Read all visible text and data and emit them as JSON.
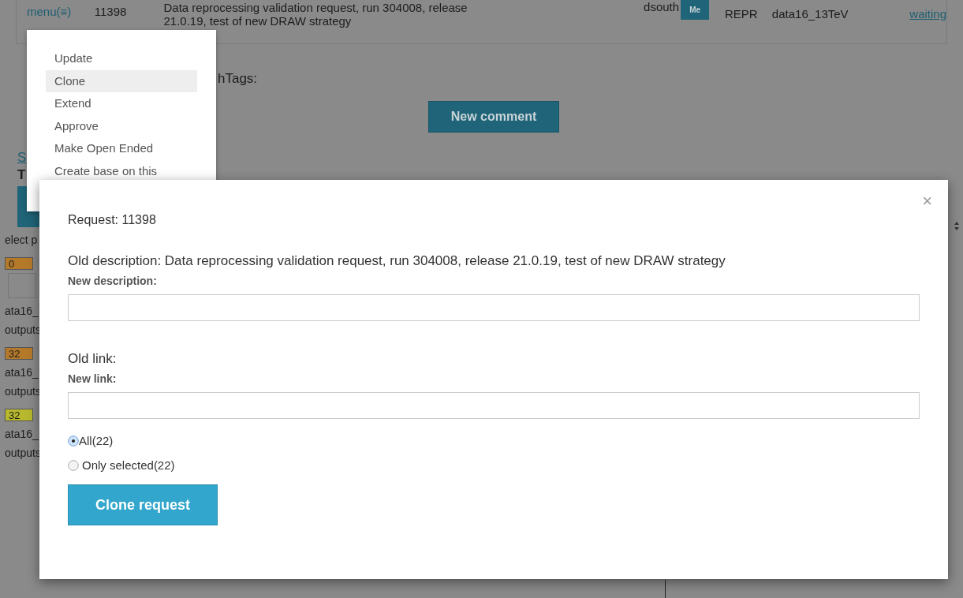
{
  "request_row": {
    "menu_link": "menu(≡)",
    "id": "11398",
    "description": "Data reprocessing validation request, run 304008, release 21.0.19, test of new DRAW strategy",
    "user": "dsouth",
    "user_badge": "Me",
    "type": "REPR",
    "project": "data16_13TeV",
    "status": "waiting"
  },
  "background": {
    "tags_label": "hTags:",
    "new_comment_button": "New comment",
    "fragments": [
      {
        "kind": "link",
        "text": "S"
      },
      {
        "kind": "bold",
        "text": "T"
      },
      {
        "kind": "button"
      },
      {
        "kind": "text",
        "text": "elect p"
      },
      {
        "kind": "badge",
        "text": "0",
        "color": "#b5792a"
      },
      {
        "kind": "cell"
      },
      {
        "kind": "text",
        "text": "ata16_"
      },
      {
        "kind": "text",
        "text": "outputs"
      },
      {
        "kind": "badge",
        "text": "32",
        "color": "#b5792a"
      },
      {
        "kind": "text",
        "text": "ata16_"
      },
      {
        "kind": "text",
        "text": "outputs"
      },
      {
        "kind": "badge",
        "text": "32",
        "color": "#b8b82e"
      },
      {
        "kind": "text",
        "text": "ata16_"
      },
      {
        "kind": "text",
        "text": "outputs"
      }
    ]
  },
  "menu": {
    "items": [
      {
        "label": "Update",
        "selected": false
      },
      {
        "label": "Clone",
        "selected": true
      },
      {
        "label": "Extend",
        "selected": false
      },
      {
        "label": "Approve",
        "selected": false
      },
      {
        "label": "Make Open Ended",
        "selected": false
      },
      {
        "label": "Create base on this",
        "selected": false
      }
    ]
  },
  "dialog": {
    "close": "×",
    "request_label": "Request: 11398",
    "old_description": "Old description: Data reprocessing validation request, run 304008, release 21.0.19, test of new DRAW strategy",
    "new_description_label": "New description:",
    "old_link": "Old link:",
    "new_link_label": "New link:",
    "scope_options": [
      {
        "label": "All(22)",
        "selected": true
      },
      {
        "label": "Only selected(22)",
        "selected": false
      }
    ],
    "submit_button": "Clone request"
  }
}
